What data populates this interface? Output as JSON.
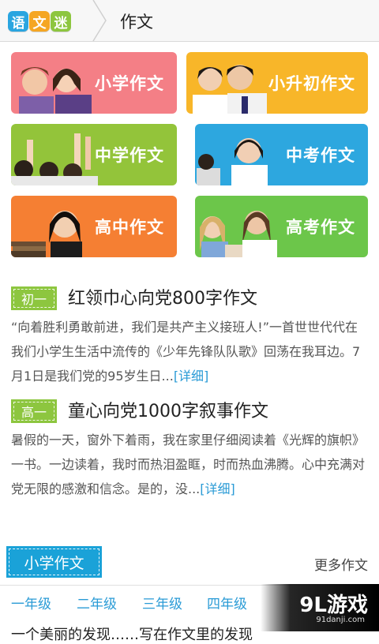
{
  "header": {
    "logo_chars": [
      "语",
      "文",
      "迷"
    ],
    "logo_colors": [
      "#2aa5e0",
      "#f5a623",
      "#8dc63f"
    ],
    "title": "作文"
  },
  "categories": [
    {
      "label": "小学作文",
      "color": "#f47f86"
    },
    {
      "label": "小升初作文",
      "color": "#f8b629"
    },
    {
      "label": "中学作文",
      "color": "#93c43a"
    },
    {
      "label": "中考作文",
      "color": "#2da7df"
    },
    {
      "label": "高中作文",
      "color": "#f57f33"
    },
    {
      "label": "高考作文",
      "color": "#6cc64a"
    }
  ],
  "articles": [
    {
      "tag": "初一",
      "title": "红领巾心向党800字作文",
      "excerpt": "“向着胜利勇敢前进，我们是共产主义接班人!”一首世世代代在我们小学生生活中流传的《少年先锋队队歌》回荡在我耳边。7月1日是我们党的95岁生日...",
      "more": "[详细]"
    },
    {
      "tag": "高一",
      "title": "童心向党1000字叙事作文",
      "excerpt": "暑假的一天，窗外下着雨，我在家里仔细阅读着《光辉的旗帜》一书。一边读着，我时而热泪盈眶，时而热血沸腾。心中充满对党无限的感激和信念。是的，没...",
      "more": "[详细]"
    }
  ],
  "section": {
    "title": "小学作文",
    "more": "更多作文",
    "grades": [
      "一年级",
      "二年级",
      "三年级",
      "四年级"
    ],
    "cut_text": "一个美丽的发现……写在作文里的发现"
  },
  "watermark": {
    "main": "9L游戏",
    "sub": "91danji.com"
  }
}
